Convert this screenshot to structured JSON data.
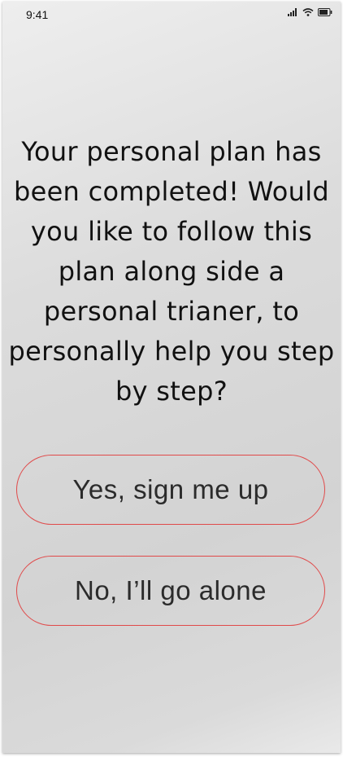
{
  "status_bar": {
    "time": "9:41",
    "icons": [
      "cellular-signal-icon",
      "wifi-icon",
      "battery-icon"
    ]
  },
  "main": {
    "question": "Your personal plan has been completed! Would you like to follow this plan along side a personal trianer, to personally help you step by step?",
    "buttons": {
      "yes_label": "Yes, sign me up",
      "no_label": "No, I’ll go alone"
    }
  },
  "colors": {
    "button_border": "#e04a4a",
    "background_top": "#eeeeee",
    "background_bottom": "#d3d3d3",
    "text": "#111111"
  }
}
